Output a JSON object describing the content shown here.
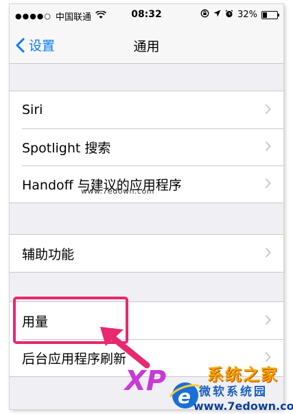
{
  "status_bar": {
    "signal_dots": "●●●●○",
    "carrier": "中国联通",
    "time": "08:32",
    "battery": "32%",
    "battery_level": 0.32
  },
  "nav": {
    "back_label": "设置",
    "title": "通用"
  },
  "groups": [
    {
      "items": [
        {
          "label": "Siri"
        },
        {
          "label": "Spotlight 搜索"
        },
        {
          "label": "Handoff 与建议的应用程序"
        }
      ]
    },
    {
      "items": [
        {
          "label": "辅助功能"
        }
      ]
    },
    {
      "items": [
        {
          "label": "用量"
        },
        {
          "label": "后台应用程序刷新"
        }
      ]
    }
  ],
  "watermark": {
    "small": "www.7edown.com",
    "xp": "XP",
    "name": "系统之家",
    "sub": "微软系统园",
    "url": "www.7edown.com"
  },
  "colors": {
    "accent": "#0a7aff",
    "highlight": "#e8286f",
    "background": "#efeff4"
  },
  "icons": [
    "wifi-icon",
    "lock-rotation-icon",
    "location-icon",
    "alarm-icon",
    "battery-icon",
    "back-chevron-icon",
    "chevron-right-icon",
    "arrow-icon"
  ]
}
